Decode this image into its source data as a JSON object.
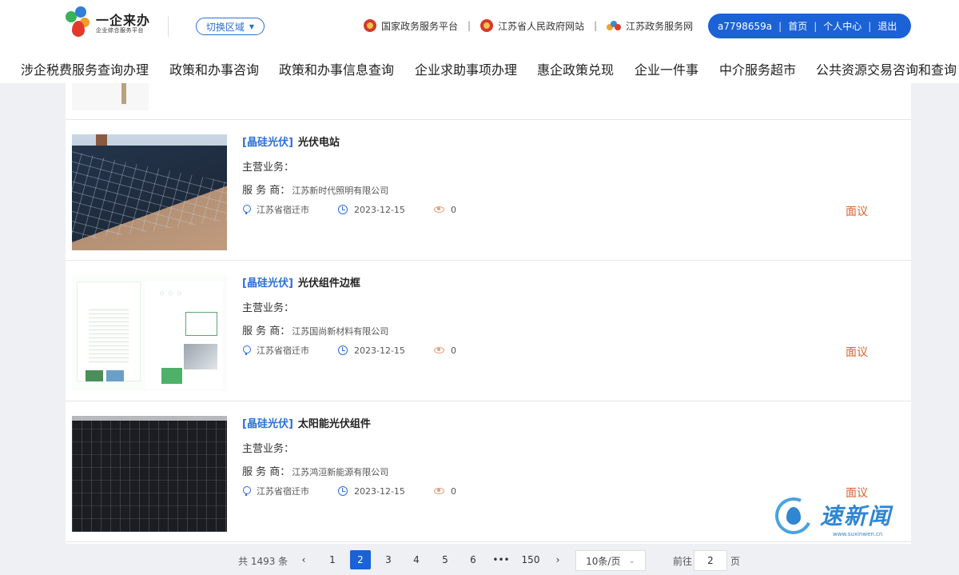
{
  "header": {
    "logo_title": "一企来办",
    "logo_subtitle": "企业综合服务平台",
    "region_button": "切换区域",
    "links": [
      {
        "label": "国家政务服务平台",
        "icon": "emblem-icon"
      },
      {
        "label": "江苏省人民政府网站",
        "icon": "emblem-icon"
      },
      {
        "label": "江苏政务服务网",
        "icon": "jiangsu-gov-icon"
      }
    ],
    "user": {
      "username": "a7798659a",
      "home": "首页",
      "center": "个人中心",
      "logout": "退出"
    }
  },
  "nav": {
    "items": [
      "涉企税费服务查询办理",
      "政策和办事咨询",
      "政策和办事信息查询",
      "企业求助事项办理",
      "惠企政策兑现",
      "企业一件事",
      "中介服务超市",
      "公共资源交易咨询和查询"
    ]
  },
  "labels": {
    "business": "主营业务：",
    "provider": "服 务 商："
  },
  "products": [
    {
      "tag": "[晶硅光伏]",
      "name": "光伏电站",
      "business": "",
      "provider": "江苏新时代照明有限公司",
      "location": "江苏省宿迁市",
      "date": "2023-12-15",
      "views": "0",
      "price": "面议",
      "thumb": "solar-roof-photo"
    },
    {
      "tag": "[晶硅光伏]",
      "name": "光伏组件边框",
      "business": "",
      "provider": "江苏国尚新材料有限公司",
      "location": "江苏省宿迁市",
      "date": "2023-12-15",
      "views": "0",
      "price": "面议",
      "thumb": "brochure-photo"
    },
    {
      "tag": "[晶硅光伏]",
      "name": "太阳能光伏组件",
      "business": "",
      "provider": "江苏鸿洹新能源有限公司",
      "location": "江苏省宿迁市",
      "date": "2023-12-15",
      "views": "0",
      "price": "面议",
      "thumb": "solar-panel-photo"
    }
  ],
  "pagination": {
    "total": "共 1493 条",
    "prev": "‹",
    "next": "›",
    "pages": [
      "1",
      "2",
      "3",
      "4",
      "5",
      "6",
      "•••",
      "150"
    ],
    "current": "2",
    "page_size": "10条/页",
    "goto_label": "前往",
    "goto_value": "2",
    "page_unit": "页"
  },
  "watermark": {
    "text": "速新闻",
    "url": "www.suxinwen.cn"
  },
  "colors": {
    "primary": "#1a62d6",
    "tag": "#2a6fd6",
    "price": "#d9622b"
  }
}
